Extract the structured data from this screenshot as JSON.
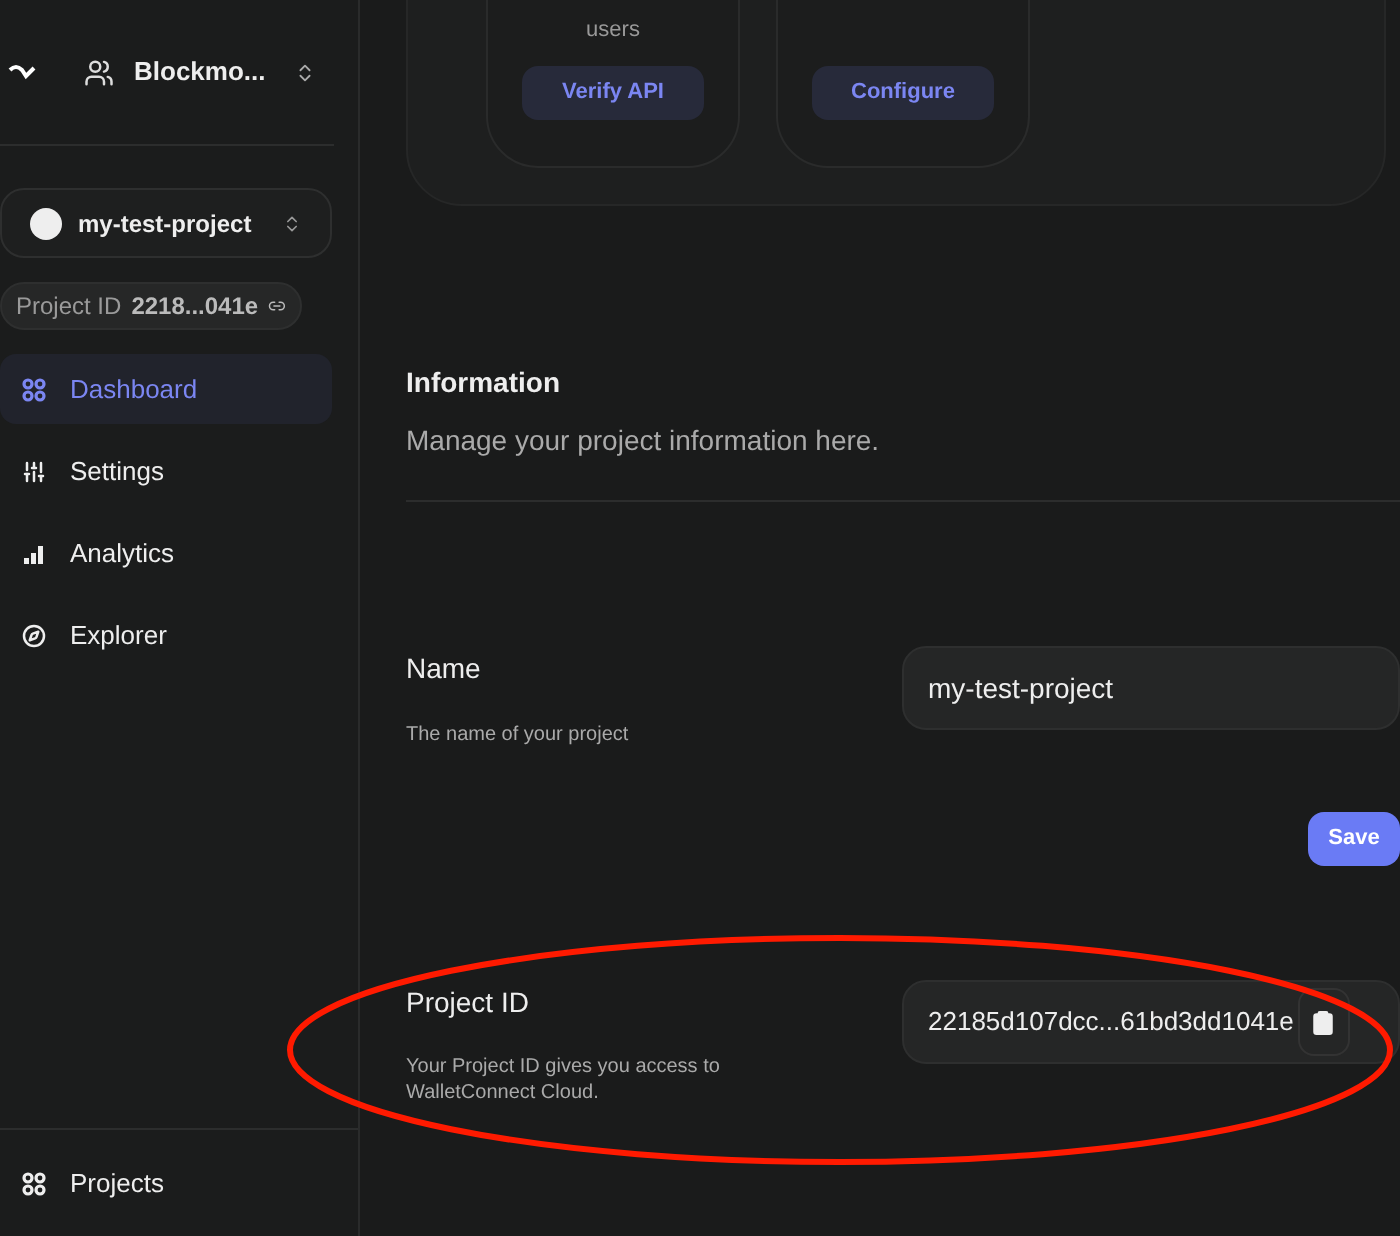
{
  "sidebar": {
    "org": "Blockmo...",
    "project": "my-test-project",
    "project_id_label": "Project ID",
    "project_id_short": "2218...041e",
    "items": [
      {
        "label": "Dashboard",
        "selected": true
      },
      {
        "label": "Settings",
        "selected": false
      },
      {
        "label": "Analytics",
        "selected": false
      },
      {
        "label": "Explorer",
        "selected": false
      }
    ],
    "footer_item": {
      "label": "Projects"
    }
  },
  "feature_cards": [
    {
      "description": "users",
      "button": "Verify API"
    },
    {
      "button": "Configure"
    }
  ],
  "information": {
    "title": "Information",
    "subtitle": "Manage your project information here."
  },
  "name_field": {
    "label": "Name",
    "hint": "The name of your project",
    "value": "my-test-project",
    "save": "Save"
  },
  "project_id_field": {
    "label": "Project ID",
    "hint": "Your Project ID gives you access to WalletConnect Cloud.",
    "value": "22185d107dcc...61bd3dd1041e"
  }
}
